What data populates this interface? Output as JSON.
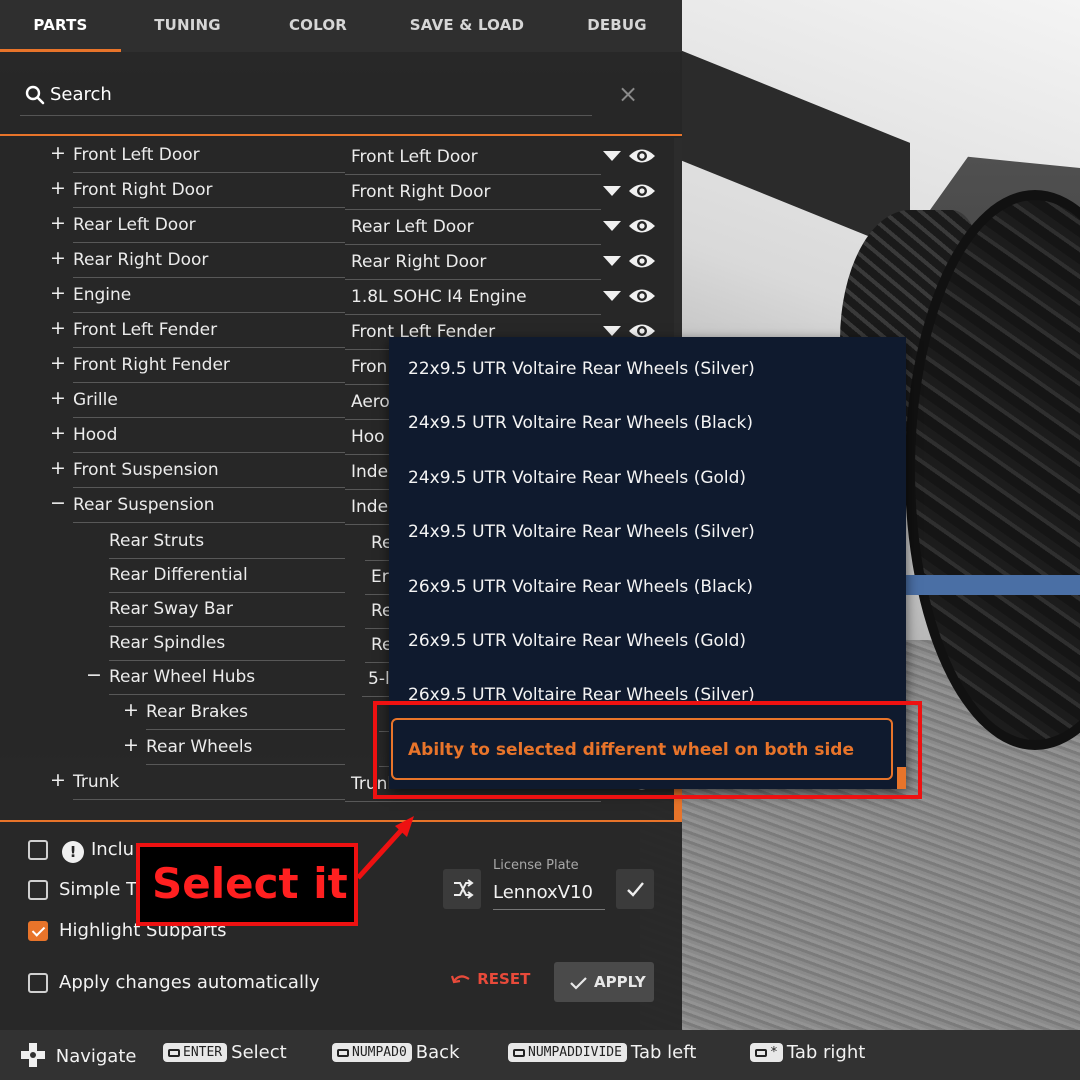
{
  "tabs": [
    "PARTS",
    "TUNING",
    "COLOR",
    "SAVE & LOAD",
    "DEBUG"
  ],
  "search": {
    "placeholder": "Search",
    "clear": "×"
  },
  "parts": [
    {
      "toggle": "+",
      "label": "Front Left Door",
      "value": "Front Left Door"
    },
    {
      "toggle": "+",
      "label": "Front Right Door",
      "value": "Front Right Door"
    },
    {
      "toggle": "+",
      "label": "Rear Left Door",
      "value": "Rear Left Door"
    },
    {
      "toggle": "+",
      "label": "Rear Right Door",
      "value": "Rear Right Door"
    },
    {
      "toggle": "+",
      "label": "Engine",
      "value": "1.8L SOHC I4 Engine"
    },
    {
      "toggle": "+",
      "label": "Front Left Fender",
      "value": "Front Left Fender"
    },
    {
      "toggle": "+",
      "label": "Front Right Fender",
      "value": "Fron"
    },
    {
      "toggle": "+",
      "label": "Grille",
      "value": "Aero"
    },
    {
      "toggle": "+",
      "label": "Hood",
      "value": "Hoo"
    },
    {
      "toggle": "+",
      "label": "Front Suspension",
      "value": "Inde"
    },
    {
      "toggle": "−",
      "label": "Rear Suspension",
      "value": "Inde"
    },
    {
      "toggle": "",
      "label": "Rear Struts",
      "value": "Re"
    },
    {
      "toggle": "",
      "label": "Rear Differential",
      "value": "Er"
    },
    {
      "toggle": "",
      "label": "Rear Sway Bar",
      "value": "Re"
    },
    {
      "toggle": "",
      "label": "Rear Spindles",
      "value": "Re"
    },
    {
      "toggle": "−",
      "label": "Rear Wheel Hubs",
      "value": "5-l"
    },
    {
      "toggle": "+",
      "label": "Rear Brakes",
      "value": ""
    },
    {
      "toggle": "+",
      "label": "Rear Wheels",
      "value": ""
    },
    {
      "toggle": "+",
      "label": "Trunk",
      "value": "Trunk"
    }
  ],
  "dropdown": {
    "items": [
      "22x9.5 UTR Voltaire Rear Wheels (Silver)",
      "24x9.5 UTR Voltaire Rear Wheels (Black)",
      "24x9.5 UTR Voltaire Rear Wheels (Gold)",
      "24x9.5 UTR Voltaire Rear Wheels (Silver)",
      "26x9.5 UTR Voltaire Rear Wheels (Black)",
      "26x9.5 UTR Voltaire Rear Wheels (Gold)",
      "26x9.5 UTR Voltaire Rear Wheels (Silver)"
    ],
    "highlighted": "Abilty to selected different wheel on both side"
  },
  "options": {
    "include_label": "Inclu",
    "simple_label": "Simple Tr",
    "highlight_label": "Highlight Subparts",
    "apply_auto_label": "Apply changes automatically",
    "license_label": "License Plate",
    "license_value": "LennoxV10"
  },
  "buttons": {
    "reset": "RESET",
    "apply": "APPLY"
  },
  "annotation": {
    "callout": "Select it"
  },
  "actions": [
    {
      "key": "",
      "label": "Navigate"
    },
    {
      "key": "ENTER",
      "label": "Select"
    },
    {
      "key": "NUMPAD0",
      "label": "Back"
    },
    {
      "key": "NUMPADDIVIDE",
      "label": "Tab left"
    },
    {
      "key": "*",
      "label": "Tab right"
    }
  ],
  "colors": {
    "accent": "#e8742a",
    "annotation": "#ee1111",
    "dropdown_bg": "#0f1a2e"
  }
}
